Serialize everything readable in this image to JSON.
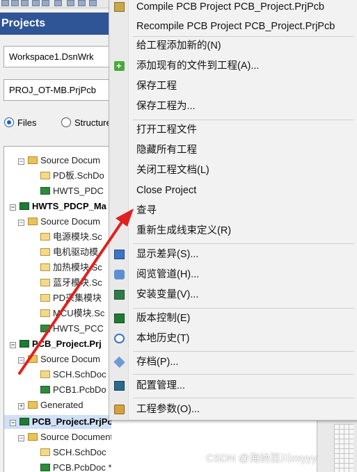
{
  "panel": {
    "title": "Projects",
    "workspace_combo": "Workspace1.DsnWrk",
    "project_combo": "PROJ_OT-MB.PrjPcb",
    "view_mode": {
      "files_label": "Files",
      "structure_label": "Structure",
      "selected": "Files"
    }
  },
  "tree": {
    "rows": [
      {
        "text": "Source Docum",
        "level": 2,
        "icon": "folder-icon",
        "expander": "−"
      },
      {
        "text": "PD板.SchDo",
        "level": 3,
        "icon": "schematic-doc-icon"
      },
      {
        "text": "HWTS_PDC",
        "level": 3,
        "icon": "pcb-doc-icon"
      },
      {
        "text": "HWTS_PDCP_Ma",
        "level": 1,
        "icon": "pcb-project-icon",
        "expander": "−",
        "bold": true
      },
      {
        "text": "Source Docum",
        "level": 2,
        "icon": "folder-icon",
        "expander": "−"
      },
      {
        "text": "电源模块.Sc",
        "level": 3,
        "icon": "schematic-doc-icon"
      },
      {
        "text": "电机驱动模",
        "level": 3,
        "icon": "schematic-doc-icon"
      },
      {
        "text": "加热模块.Sc",
        "level": 3,
        "icon": "schematic-doc-icon"
      },
      {
        "text": "蓝牙模块.Sc",
        "level": 3,
        "icon": "schematic-doc-icon"
      },
      {
        "text": "PD采集模块",
        "level": 3,
        "icon": "schematic-doc-icon"
      },
      {
        "text": "MCU模块.Sc",
        "level": 3,
        "icon": "schematic-doc-icon"
      },
      {
        "text": "HWTS_PCC",
        "level": 3,
        "icon": "pcb-doc-icon"
      },
      {
        "text": "PCB_Project.Prj",
        "level": 1,
        "icon": "pcb-project-icon",
        "expander": "−",
        "bold": true
      },
      {
        "text": "Source Docum",
        "level": 2,
        "icon": "folder-icon",
        "expander": "−"
      },
      {
        "text": "SCH.SchDoc",
        "level": 3,
        "icon": "schematic-doc-icon"
      },
      {
        "text": "PCB1.PcbDo",
        "level": 3,
        "icon": "pcb-doc-icon"
      },
      {
        "text": "Generated",
        "level": 2,
        "icon": "folder-icon",
        "expander": "+"
      },
      {
        "text": "PCB_Project.PrjPcb",
        "level": 1,
        "icon": "pcb-project-icon",
        "expander": "−",
        "bold": true,
        "selected": true
      },
      {
        "text": "Source Documents",
        "level": 2,
        "icon": "folder-icon",
        "expander": "−"
      },
      {
        "text": "SCH.SchDoc",
        "level": 3,
        "icon": "schematic-doc-icon"
      },
      {
        "text": "PCB.PcbDoc *",
        "level": 3,
        "icon": "pcb-doc-icon"
      }
    ]
  },
  "context_menu": {
    "items": [
      {
        "label": "Compile PCB Project PCB_Project.PrjPcb",
        "icon": "compile-icon",
        "mnemonic_underline": "C"
      },
      {
        "label": "Recompile PCB Project PCB_Project.PrjPcb",
        "mnemonic_underline": "R"
      },
      {
        "separator": true
      },
      {
        "label": "给工程添加新的(N)"
      },
      {
        "label": "添加现有的文件到工程(A)...",
        "icon": "add-file-icon"
      },
      {
        "label": "保存工程"
      },
      {
        "label": "保存工程为..."
      },
      {
        "separator": true
      },
      {
        "label": "打开工程文件"
      },
      {
        "label": "隐藏所有工程"
      },
      {
        "label": "关闭工程文档(L)"
      },
      {
        "label": "Close Project"
      },
      {
        "label": "查寻"
      },
      {
        "label": "重新生成线束定义(R)"
      },
      {
        "separator": true
      },
      {
        "label": "显示差异(S)...",
        "icon": "diff-icon"
      },
      {
        "label": "阅览管道(H)...",
        "icon": "browse-channels-icon"
      },
      {
        "label": "安装变量(V)...",
        "icon": "variants-icon"
      },
      {
        "separator": true
      },
      {
        "label": "版本控制(E)",
        "icon": "version-control-icon"
      },
      {
        "label": "本地历史(T)",
        "icon": "local-history-icon"
      },
      {
        "separator": true
      },
      {
        "label": "存档(P)...",
        "icon": "archive-icon"
      },
      {
        "separator": true
      },
      {
        "label": "配置管理...",
        "icon": "configuration-icon"
      },
      {
        "separator": true
      },
      {
        "label": "工程参数(O)...",
        "icon": "project-parameters-icon"
      }
    ]
  },
  "watermark": "CSDN @海纳百川xxyyy",
  "colors": {
    "panel_title_bg": "#2f5597",
    "annotation_arrow": "#e02020",
    "selection_bg": "#cfe0f7"
  }
}
